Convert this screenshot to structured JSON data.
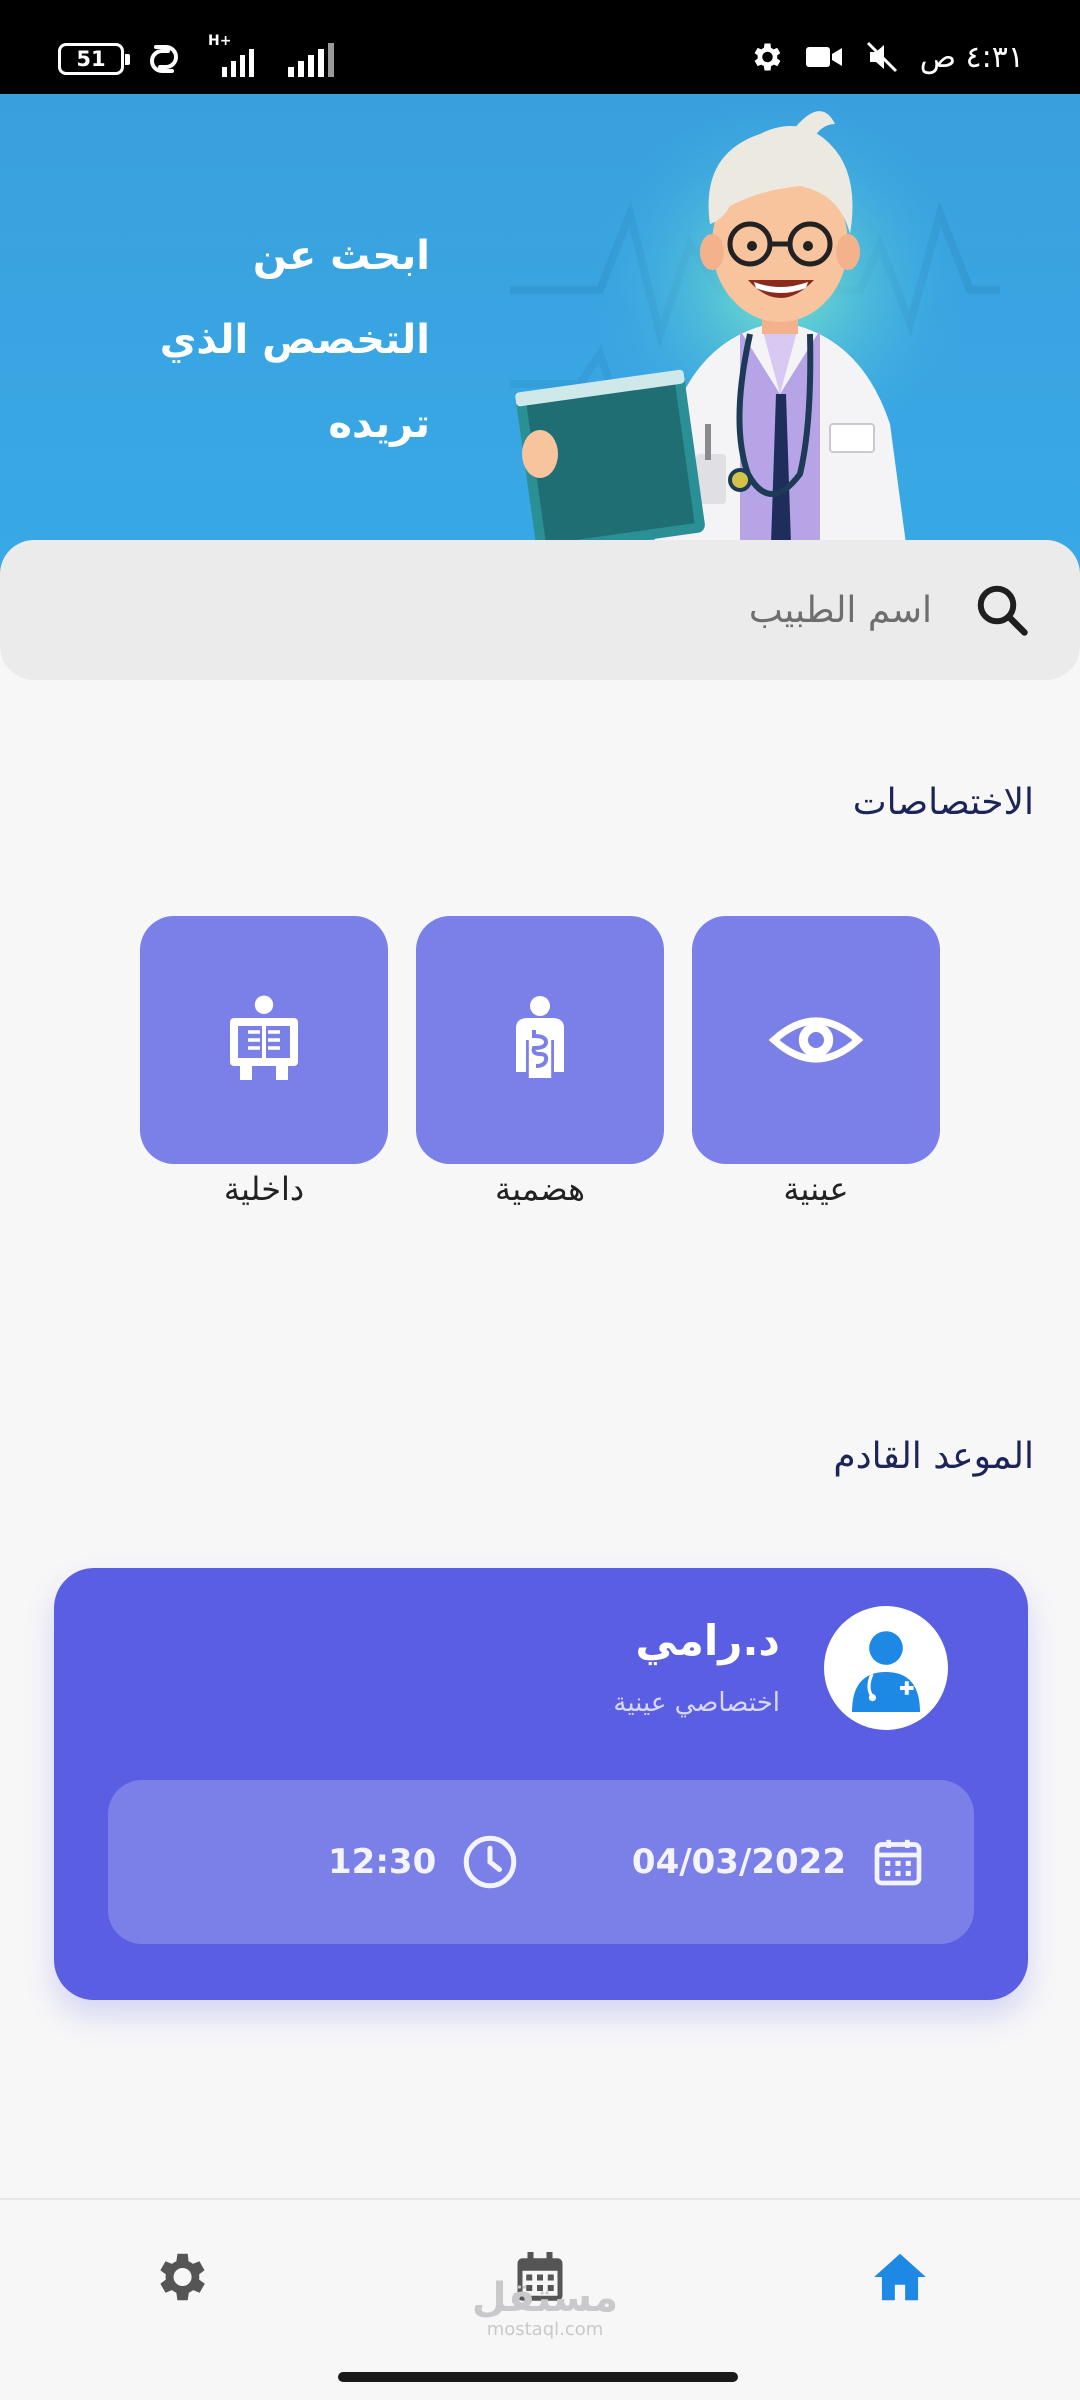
{
  "status_bar": {
    "battery": "51",
    "network": "H+",
    "time": "٤:٣١ ص"
  },
  "hero": {
    "line1": "ابحث عن",
    "line2": "التخصص الذي",
    "line3": "تريده"
  },
  "search": {
    "placeholder": "اسم الطبيب"
  },
  "specialties": {
    "title": "الاختصاصات",
    "items": [
      {
        "label": "عينية",
        "icon": "eye-icon"
      },
      {
        "label": "هضمية",
        "icon": "digestive-system-icon"
      },
      {
        "label": "داخلية",
        "icon": "xray-icon"
      }
    ]
  },
  "next_appointment": {
    "title": "الموعد القادم",
    "doctor_name": "د.رامي",
    "doctor_specialty": "اختصاصي عينية",
    "date": "04/03/2022",
    "time": "12:30"
  },
  "bottom_nav": {
    "items": [
      "gear-icon",
      "calendar-icon",
      "home-icon"
    ],
    "active": "home-icon",
    "active_color": "#1e88e5"
  },
  "watermark": {
    "text": "مستقل",
    "domain": "mostaql.com"
  },
  "colors": {
    "hero_bg": "#38a9e6",
    "card": "#7b7fe8",
    "appointment_card": "#5a5ee2",
    "title_text": "#1d2458"
  }
}
